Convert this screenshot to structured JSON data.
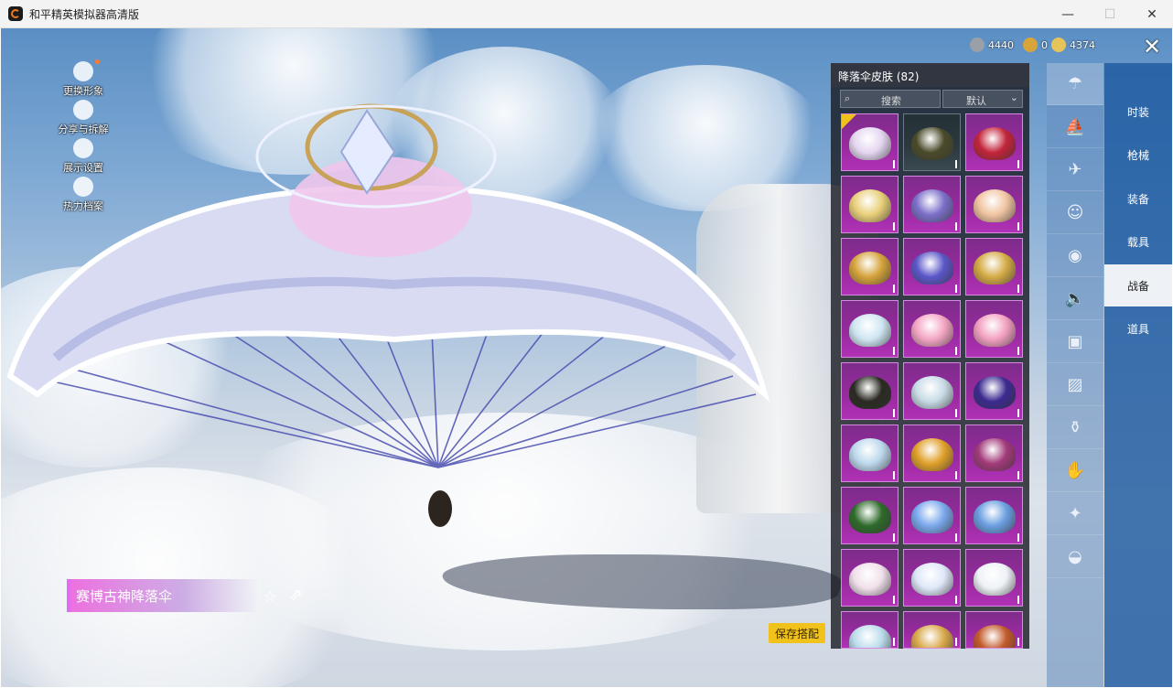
{
  "window": {
    "title": "和平精英模拟器高清版"
  },
  "window_controls": [
    "—",
    "☐",
    "✕"
  ],
  "left_menu": [
    {
      "label": "更换形象",
      "icon": "avatar-icon",
      "dot": true
    },
    {
      "label": "分享与拆解",
      "icon": "split-icon",
      "dot": false
    },
    {
      "label": "展示设置",
      "icon": "eye-icon",
      "dot": false
    },
    {
      "label": "热力档案",
      "icon": "flame-icon",
      "dot": false
    }
  ],
  "item_name": "赛博古神降落伞",
  "save_button": "保存搭配",
  "currency": [
    {
      "value": "4440",
      "icon": "silver-coin-icon",
      "color": "#9aa0a8"
    },
    {
      "value": "0",
      "icon": "gold-coin-icon",
      "color": "#d8a53a"
    },
    {
      "value": "4374",
      "icon": "diamond-coin-icon",
      "color": "#e6c45a"
    }
  ],
  "panel": {
    "title": "降落伞皮肤 (82)",
    "search_placeholder": "搜索",
    "sort_value": "默认"
  },
  "skins": [
    {
      "color": "#e4d6f0",
      "style": "purple",
      "selected": true
    },
    {
      "color": "#4a4a2a",
      "style": "dark",
      "selected": false
    },
    {
      "color": "#c3243a",
      "style": "purple",
      "selected": false
    },
    {
      "color": "#e8cf78",
      "style": "purple",
      "selected": false
    },
    {
      "color": "#7b6fc9",
      "style": "purple",
      "selected": false
    },
    {
      "color": "#f0c4a0",
      "style": "purple",
      "selected": false
    },
    {
      "color": "#d4a23a",
      "style": "purple",
      "selected": false
    },
    {
      "color": "#5a56c8",
      "style": "purple",
      "selected": false
    },
    {
      "color": "#d4aa44",
      "style": "purple",
      "selected": false
    },
    {
      "color": "#cfe6f2",
      "style": "purple",
      "selected": false
    },
    {
      "color": "#f4a6c4",
      "style": "purple",
      "selected": false
    },
    {
      "color": "#f2a0c0",
      "style": "purple",
      "selected": false
    },
    {
      "color": "#2a2a22",
      "style": "purple",
      "selected": false
    },
    {
      "color": "#c8dbe6",
      "style": "purple",
      "selected": false
    },
    {
      "color": "#3c2a90",
      "style": "purple",
      "selected": false
    },
    {
      "color": "#bcd8ec",
      "style": "purple",
      "selected": false
    },
    {
      "color": "#e0a02a",
      "style": "purple",
      "selected": false
    },
    {
      "color": "#a23a7a",
      "style": "purple",
      "selected": false
    },
    {
      "color": "#2e6a2a",
      "style": "purple",
      "selected": false
    },
    {
      "color": "#7aa8ec",
      "style": "purple",
      "selected": false
    },
    {
      "color": "#6a9ee0",
      "style": "purple",
      "selected": false
    },
    {
      "color": "#f0e0ea",
      "style": "purple",
      "selected": false
    },
    {
      "color": "#dfe8f8",
      "style": "purple",
      "selected": false
    },
    {
      "color": "#eef2f6",
      "style": "purple",
      "selected": false
    },
    {
      "color": "#bcdcec",
      "style": "purple",
      "selected": false
    },
    {
      "color": "#d8a84a",
      "style": "purple",
      "selected": false
    },
    {
      "color": "#c25a2a",
      "style": "purple",
      "selected": false
    }
  ],
  "icon_tabs": [
    {
      "icon": "parachute-icon",
      "active": true
    },
    {
      "icon": "boat-icon",
      "active": false
    },
    {
      "icon": "plane-icon",
      "active": false
    },
    {
      "icon": "emote-icon",
      "active": false
    },
    {
      "icon": "robot-icon",
      "active": false
    },
    {
      "icon": "sound-icon",
      "active": false
    },
    {
      "icon": "chat-icon",
      "active": false
    },
    {
      "icon": "image-icon",
      "active": false
    },
    {
      "icon": "spray-icon",
      "active": false
    },
    {
      "icon": "hand-icon",
      "active": false
    },
    {
      "icon": "sparkle-icon",
      "active": false
    },
    {
      "icon": "pan-icon",
      "active": false
    }
  ],
  "categories": [
    {
      "label": "时装",
      "active": false
    },
    {
      "label": "枪械",
      "active": false
    },
    {
      "label": "装备",
      "active": false
    },
    {
      "label": "载具",
      "active": false
    },
    {
      "label": "战备",
      "active": true
    },
    {
      "label": "道具",
      "active": false
    }
  ]
}
